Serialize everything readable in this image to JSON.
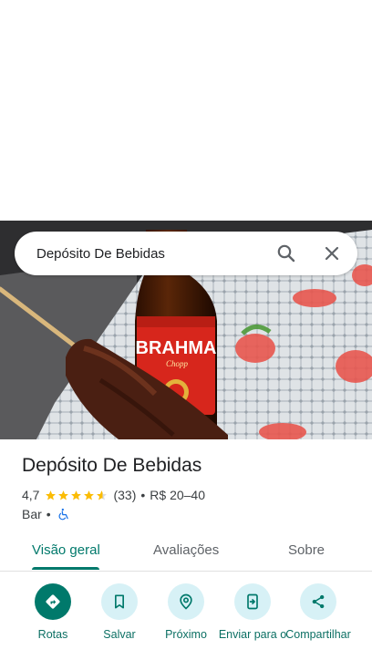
{
  "search": {
    "value": "Depósito De Bebidas"
  },
  "place": {
    "name": "Depósito De Bebidas",
    "rating": "4,7",
    "rating_value": 4.7,
    "review_count": "(33)",
    "separator": "•",
    "price": "R$ 20–40",
    "category": "Bar",
    "category_separator": "•",
    "accessibility_icon": "wheelchair-icon"
  },
  "photo": {
    "bottle_brand": "BRAHMA",
    "bottle_sub": "Chopp"
  },
  "tabs": [
    {
      "label": "Visão geral",
      "active": true
    },
    {
      "label": "Avaliações",
      "active": false
    },
    {
      "label": "Sobre",
      "active": false
    }
  ],
  "actions": [
    {
      "label": "Rotas",
      "icon": "directions-icon"
    },
    {
      "label": "Salvar",
      "icon": "bookmark-icon"
    },
    {
      "label": "Próximo",
      "icon": "nearby-icon"
    },
    {
      "label": "Enviar para o",
      "icon": "send-to-phone-icon"
    },
    {
      "label": "Compartilhar",
      "icon": "share-icon"
    }
  ],
  "colors": {
    "accent": "#00796b",
    "action_bg": "#d7f1f6",
    "star": "#fbbc04",
    "wheelchair": "#1a73e8"
  }
}
